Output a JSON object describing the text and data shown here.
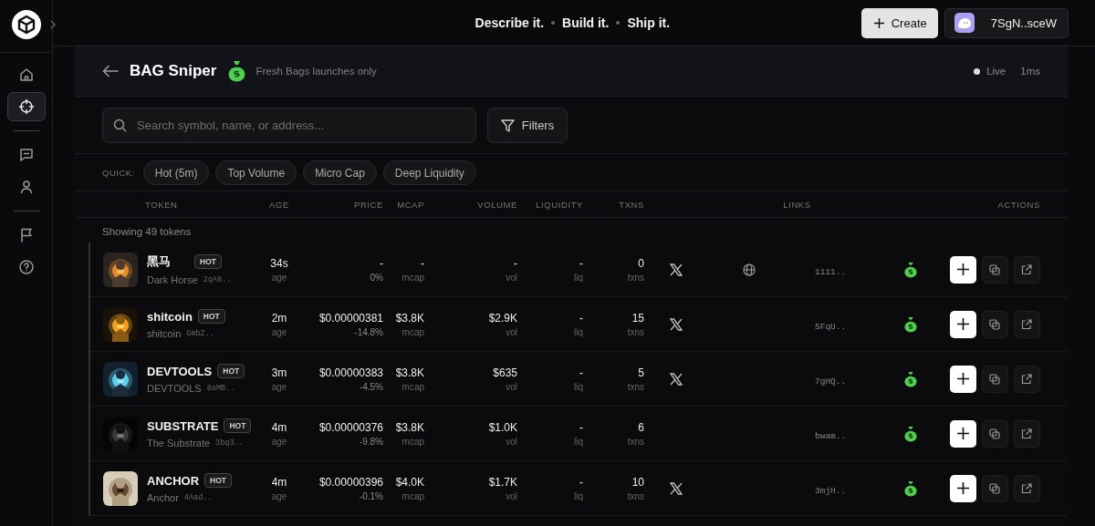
{
  "topbar": {
    "tagline": [
      "Describe it.",
      "Build it.",
      "Ship it."
    ],
    "create_button": "Create",
    "wallet": "7SgN..sceW"
  },
  "sidebar": {
    "groups": [
      [
        {
          "kind": "home",
          "selected": false
        },
        {
          "kind": "target",
          "selected": true
        }
      ],
      [
        {
          "kind": "chat",
          "selected": false
        },
        {
          "kind": "user",
          "selected": false
        }
      ],
      [
        {
          "kind": "flag",
          "selected": false
        },
        {
          "kind": "help",
          "selected": false
        }
      ]
    ]
  },
  "header": {
    "title": "BAG Sniper",
    "subtitle": "Fresh Bags launches only",
    "status": "Live",
    "latency": "1ms"
  },
  "search": {
    "placeholder": "Search symbol, name, or address..."
  },
  "filters_button": "Filters",
  "quick": {
    "label": "QUICK:",
    "chips": [
      "Hot (5m)",
      "Top Volume",
      "Micro Cap",
      "Deep Liquidity"
    ]
  },
  "table": {
    "columns": [
      "TOKEN",
      "AGE",
      "PRICE",
      "MCAP",
      "VOLUME",
      "LIQUIDITY",
      "TXNS",
      "LINKS",
      "ACTIONS"
    ],
    "count": "Showing 49 tokens",
    "rows": [
      {
        "name": "黑马",
        "badge": "HOT",
        "subtitle": "Dark Horse",
        "short": "2qA8..",
        "age": "34s",
        "age_unit": "age",
        "price": "-",
        "change": "0%",
        "mcap": "-",
        "mcap_unit": "mcap",
        "volume": "-",
        "vol_unit": "vol",
        "liquidity": "-",
        "liq_unit": "liq",
        "txns": "0",
        "txns_unit": "txns",
        "twitter": true,
        "website": true,
        "address": "1111.."
      },
      {
        "name": "shitcoin",
        "badge": "HOT",
        "subtitle": "shitcoin",
        "short": "GmbZ..",
        "age": "2m",
        "age_unit": "age",
        "price": "$0.00000381",
        "change": "-14.8%",
        "mcap": "$3.8K",
        "mcap_unit": "mcap",
        "volume": "$2.9K",
        "vol_unit": "vol",
        "liquidity": "-",
        "liq_unit": "liq",
        "txns": "15",
        "txns_unit": "txns",
        "twitter": true,
        "website": false,
        "address": "5FqU.."
      },
      {
        "name": "DEVTOOLS",
        "badge": "HOT",
        "subtitle": "DEVTOOLS",
        "short": "8aMB..",
        "age": "3m",
        "age_unit": "age",
        "price": "$0.00000383",
        "change": "-4.5%",
        "mcap": "$3.8K",
        "mcap_unit": "mcap",
        "volume": "$635",
        "vol_unit": "vol",
        "liquidity": "-",
        "liq_unit": "liq",
        "txns": "5",
        "txns_unit": "txns",
        "twitter": true,
        "website": false,
        "address": "7gHQ.."
      },
      {
        "name": "SUBSTRATE",
        "badge": "HOT",
        "subtitle": "The Substrate",
        "short": "3bq3..",
        "age": "4m",
        "age_unit": "age",
        "price": "$0.00000376",
        "change": "-9.8%",
        "mcap": "$3.8K",
        "mcap_unit": "mcap",
        "volume": "$1.0K",
        "vol_unit": "vol",
        "liquidity": "-",
        "liq_unit": "liq",
        "txns": "6",
        "txns_unit": "txns",
        "twitter": false,
        "website": false,
        "address": "bwam.."
      },
      {
        "name": "ANCHOR",
        "badge": "HOT",
        "subtitle": "Anchor",
        "short": "4Aad..",
        "age": "4m",
        "age_unit": "age",
        "price": "$0.00000396",
        "change": "-0.1%",
        "mcap": "$4.0K",
        "mcap_unit": "mcap",
        "volume": "$1.7K",
        "vol_unit": "vol",
        "liquidity": "-",
        "liq_unit": "liq",
        "txns": "10",
        "txns_unit": "txns",
        "twitter": true,
        "website": false,
        "address": "3mjH.."
      }
    ]
  }
}
